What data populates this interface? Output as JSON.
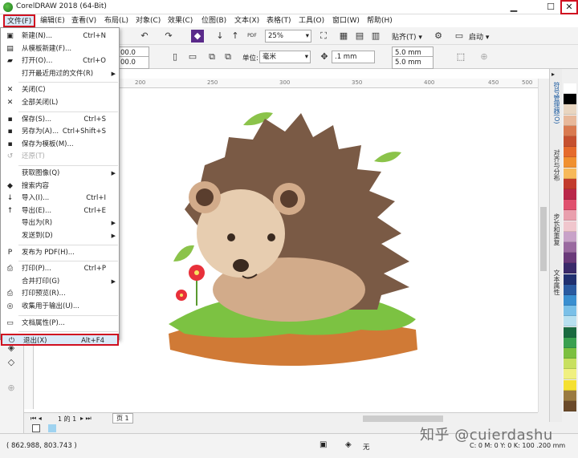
{
  "window": {
    "title": "CorelDRAW 2018 (64-Bit)"
  },
  "menubar": [
    "文件(F)",
    "编辑(E)",
    "查看(V)",
    "布局(L)",
    "对象(C)",
    "效果(C)",
    "位图(B)",
    "文本(X)",
    "表格(T)",
    "工具(O)",
    "窗口(W)",
    "帮助(H)"
  ],
  "toolbar1": {
    "zoom": "25%",
    "snap_label": "贴齐(T)",
    "launch_label": "启动"
  },
  "toolbar2": {
    "width_val": "00.0 mm",
    "height_val": "00.0 mm",
    "unit_label": "单位:",
    "unit_value": "毫米",
    "nudge_value": ".1 mm",
    "dup_x": "5.0 mm",
    "dup_y": "5.0 mm"
  },
  "ruler": [
    "200",
    "250",
    "300",
    "350",
    "400",
    "450",
    "500"
  ],
  "filemenu": [
    {
      "icon": "new-icon",
      "glyph": "▣",
      "label": "新建(N)...",
      "shortcut": "Ctrl+N"
    },
    {
      "icon": "template-icon",
      "glyph": "▤",
      "label": "从模板新建(F)..."
    },
    {
      "icon": "open-icon",
      "glyph": "▰",
      "label": "打开(O)...",
      "shortcut": "Ctrl+O"
    },
    {
      "label": "打开最近用过的文件(R)",
      "submenu": true
    },
    {
      "sep": true
    },
    {
      "icon": "close-doc-icon",
      "glyph": "✕",
      "label": "关闭(C)"
    },
    {
      "icon": "close-all-icon",
      "glyph": "✕",
      "label": "全部关闭(L)"
    },
    {
      "sep": true
    },
    {
      "icon": "save-icon",
      "glyph": "▪",
      "label": "保存(S)...",
      "shortcut": "Ctrl+S"
    },
    {
      "icon": "save-as-icon",
      "glyph": "▪",
      "label": "另存为(A)...",
      "shortcut": "Ctrl+Shift+S"
    },
    {
      "icon": "save-template-icon",
      "glyph": "▪",
      "label": "保存为模板(M)..."
    },
    {
      "icon": "revert-icon",
      "glyph": "↺",
      "label": "还原(T)",
      "disabled": true
    },
    {
      "sep": true
    },
    {
      "label": "获取图像(Q)",
      "submenu": true
    },
    {
      "icon": "search-content-icon",
      "glyph": "◆",
      "label": "搜索内容"
    },
    {
      "icon": "import-icon",
      "glyph": "↓",
      "label": "导入(I)...",
      "shortcut": "Ctrl+I"
    },
    {
      "icon": "export-icon",
      "glyph": "↑",
      "label": "导出(E)...",
      "shortcut": "Ctrl+E"
    },
    {
      "label": "导出为(R)",
      "submenu": true
    },
    {
      "label": "发送到(D)",
      "submenu": true
    },
    {
      "sep": true
    },
    {
      "icon": "pdf-icon",
      "glyph": "P",
      "label": "发布为 PDF(H)..."
    },
    {
      "sep": true
    },
    {
      "icon": "print-icon",
      "glyph": "⎙",
      "label": "打印(P)...",
      "shortcut": "Ctrl+P"
    },
    {
      "label": "合并打印(G)",
      "submenu": true
    },
    {
      "icon": "print-preview-icon",
      "glyph": "⎙",
      "label": "打印预览(R)..."
    },
    {
      "icon": "collect-output-icon",
      "glyph": "◎",
      "label": "收集用于输出(U)..."
    },
    {
      "sep": true
    },
    {
      "icon": "doc-props-icon",
      "glyph": "▭",
      "label": "文档属性(P)..."
    },
    {
      "sep": true
    },
    {
      "icon": "exit-icon",
      "glyph": "⏻",
      "label": "退出(X)",
      "shortcut": "Alt+F4",
      "highlight": true
    }
  ],
  "dockers": [
    "符号管理器(O)",
    "对齐与分布",
    "步长和重复",
    "文本属性"
  ],
  "palette": [
    "#ffffff",
    "#000000",
    "#e9d6c1",
    "#e8b89a",
    "#d97a50",
    "#c5502f",
    "#e56a2c",
    "#f09030",
    "#f7b95a",
    "#c23b2c",
    "#b9274a",
    "#e0506e",
    "#e99fad",
    "#f0c6cd",
    "#c8a2c8",
    "#9a6aa0",
    "#6a3a7a",
    "#3a2a6a",
    "#203070",
    "#2a5aa0",
    "#3a8fd0",
    "#7ac0e8",
    "#b8e0f0",
    "#1a6a40",
    "#3aa050",
    "#7cc040",
    "#c8e060",
    "#f0f080",
    "#f5e030",
    "#9a7a40",
    "#6a4a2a"
  ],
  "page": {
    "info": "1 的 1",
    "tab": "页 1"
  },
  "status": {
    "coords": "( 862.988, 803.743 )",
    "fill": "无",
    "color_info": "C: 0 M: 0 Y: 0 K: 100  .200 mm"
  },
  "watermark": "知乎 @cuierdashu"
}
